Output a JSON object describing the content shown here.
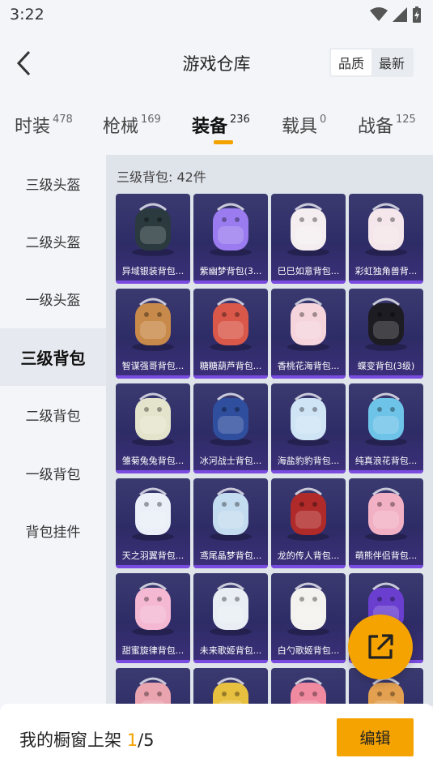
{
  "status_bar": {
    "time": "3:22"
  },
  "header": {
    "title": "游戏仓库",
    "sort_options": [
      {
        "label": "品质",
        "active": true
      },
      {
        "label": "最新",
        "active": false
      }
    ]
  },
  "category_tabs": [
    {
      "label": "时装",
      "count": "478",
      "active": false
    },
    {
      "label": "枪械",
      "count": "169",
      "active": false
    },
    {
      "label": "装备",
      "count": "236",
      "active": true
    },
    {
      "label": "载具",
      "count": "0",
      "active": false
    },
    {
      "label": "战备",
      "count": "125",
      "active": false
    }
  ],
  "sidebar": {
    "items": [
      {
        "label": "三级头盔",
        "active": false
      },
      {
        "label": "二级头盔",
        "active": false
      },
      {
        "label": "一级头盔",
        "active": false
      },
      {
        "label": "三级背包",
        "active": true
      },
      {
        "label": "二级背包",
        "active": false
      },
      {
        "label": "一级背包",
        "active": false
      },
      {
        "label": "背包挂件",
        "active": false
      }
    ]
  },
  "content": {
    "section_label": "三级背包: 42件",
    "items": [
      {
        "name": "异域银装背包...",
        "icon": "dark-tech-backpack",
        "color": "#2a3a3e"
      },
      {
        "name": "紫幽梦背包(3...",
        "icon": "purple-flower-backpack",
        "color": "#9a7cf0"
      },
      {
        "name": "巳巳如意背包...",
        "icon": "white-snake-backpack",
        "color": "#f4eef0"
      },
      {
        "name": "彩虹独角兽背...",
        "icon": "unicorn-backpack",
        "color": "#f4e6ea"
      },
      {
        "name": "智谋强哥背包...",
        "icon": "bear-backpack",
        "color": "#c88a4a"
      },
      {
        "name": "糖糖葫芦背包...",
        "icon": "red-mask-backpack",
        "color": "#d9584a"
      },
      {
        "name": "香桃花海背包...",
        "icon": "pink-flower-backpack",
        "color": "#f6d4dc"
      },
      {
        "name": "蝶变背包(3级)",
        "icon": "black-butterfly-backpack",
        "color": "#1c1c22"
      },
      {
        "name": "雏菊兔兔背包...",
        "icon": "daisy-backpack",
        "color": "#e4e4cc"
      },
      {
        "name": "冰河战士背包...",
        "icon": "blue-robot-backpack",
        "color": "#2f4e9e"
      },
      {
        "name": "海盐豹豹背包...",
        "icon": "seal-backpack",
        "color": "#cfe4f4"
      },
      {
        "name": "纯真浪花背包...",
        "icon": "drink-backpack",
        "color": "#6ec4e8"
      },
      {
        "name": "天之羽翼背包...",
        "icon": "wing-backpack",
        "color": "#eaeff8"
      },
      {
        "name": "鸢尾晶梦背包...",
        "icon": "crystal-backpack",
        "color": "#c4dcf0"
      },
      {
        "name": "龙的传人背包...",
        "icon": "red-dragon-backpack",
        "color": "#b02a2a"
      },
      {
        "name": "萌熊伴侣背包...",
        "icon": "pink-bear-backpack",
        "color": "#f2b0c4"
      },
      {
        "name": "甜蜜旋律背包...",
        "icon": "cake-backpack",
        "color": "#f4b8d2"
      },
      {
        "name": "未来歌姬背包...",
        "icon": "white-doll-backpack",
        "color": "#e8eef4"
      },
      {
        "name": "白勺歌姬背包...",
        "icon": "white-bun-backpack",
        "color": "#f4f2ee"
      },
      {
        "name": "",
        "icon": "purple-grenade-backpack",
        "color": "#6a3fd0"
      },
      {
        "name": "",
        "icon": "pink-backpack",
        "color": "#e9a4b0"
      },
      {
        "name": "",
        "icon": "yellow-backpack",
        "color": "#e8c040"
      },
      {
        "name": "",
        "icon": "pink-cat-backpack",
        "color": "#f08aa0"
      },
      {
        "name": "",
        "icon": "shiba-backpack",
        "color": "#e2a050"
      }
    ]
  },
  "fab": {
    "icon": "share-icon"
  },
  "bottom_bar": {
    "prefix": "我的橱窗上架 ",
    "current": "1",
    "suffix": "/5",
    "edit_label": "编辑"
  },
  "colors": {
    "accent": "#f5a300",
    "card_bg": "#2e2c66",
    "card_strip": "#7a4be0"
  }
}
